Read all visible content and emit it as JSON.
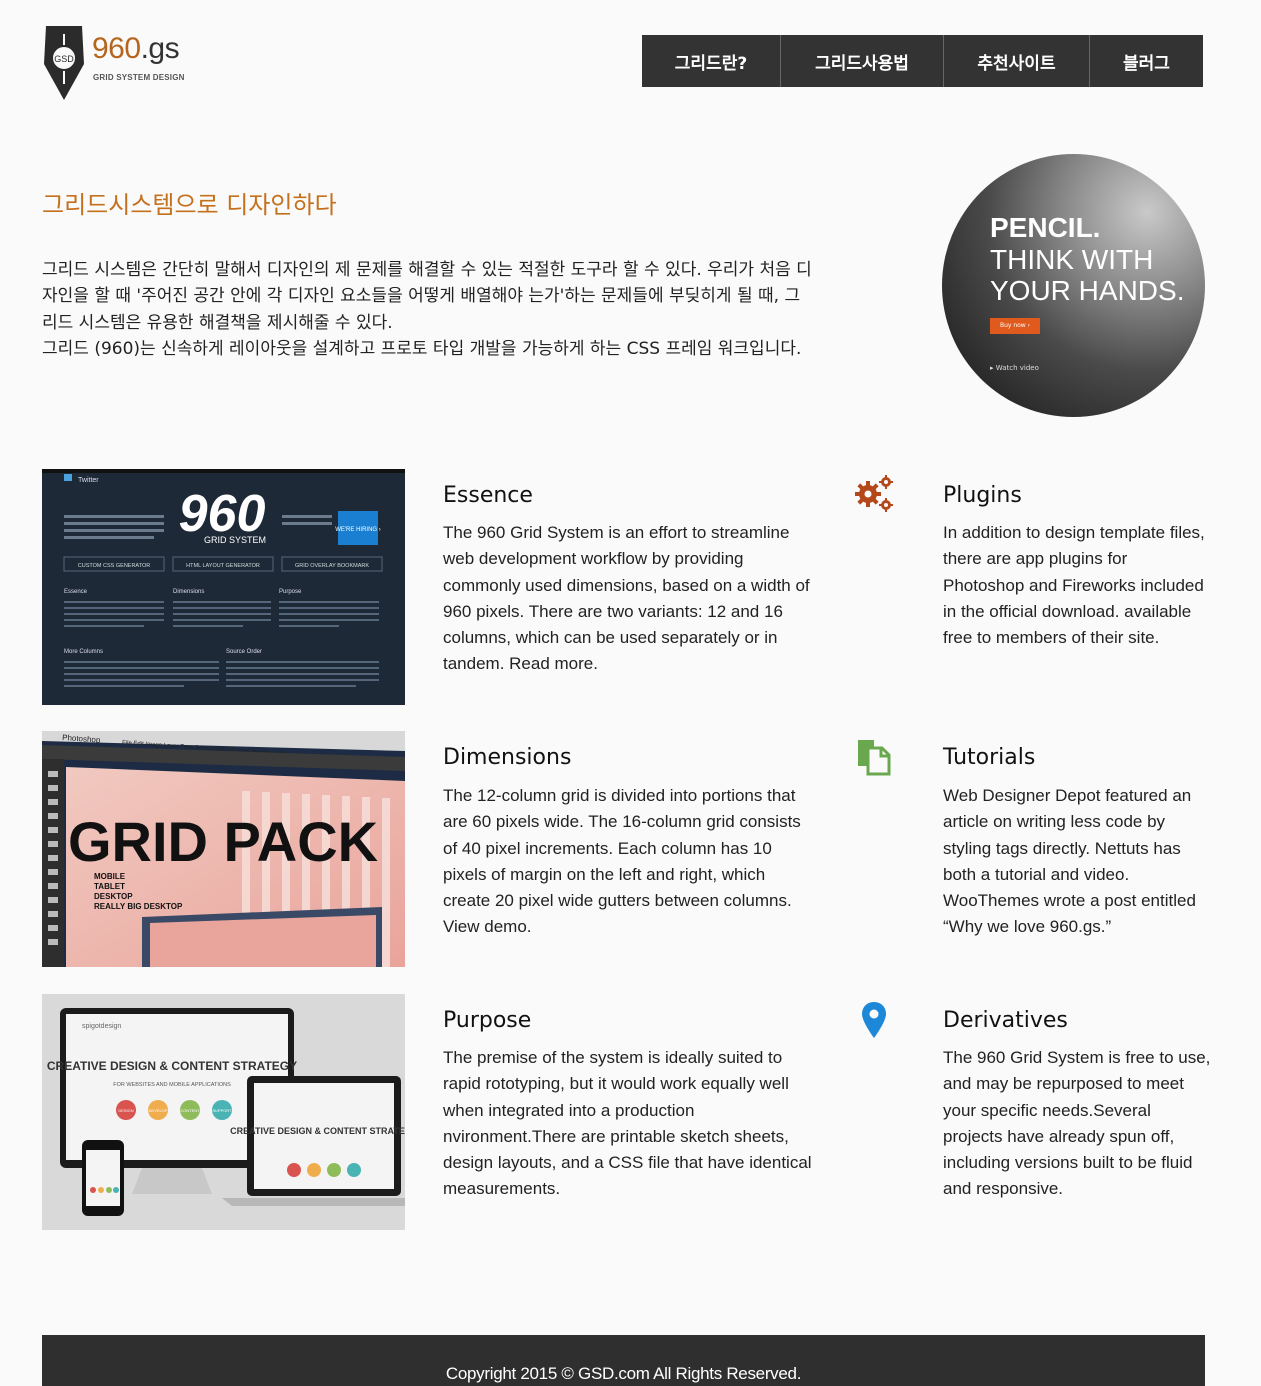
{
  "logo": {
    "badge_text": "GSD",
    "brand_prefix": "960",
    "brand_suffix": ".gs",
    "tagline": "GRID SYSTEM DESIGN"
  },
  "nav": {
    "items": [
      {
        "label": "그리드란?"
      },
      {
        "label": "그리드사용법"
      },
      {
        "label": "추천사이트"
      },
      {
        "label": "블러그"
      }
    ]
  },
  "intro": {
    "title": "그리드시스템으로 디자인하다",
    "paragraph1": "그리드 시스템은 간단히 말해서 디자인의 제 문제를 해결할 수 있는 적절한 도구라 할 수 있다. 우리가 처음 디자인을 할 때 '주어진 공간 안에 각 디자인 요소들을 어떻게 배열해야 는가'하는 문제들에 부딪히게 될 때, 그리드 시스템은 유용한 해결책을 제시해줄 수 있다.",
    "paragraph2": "그리드 (960)는 신속하게 레이아웃을 설계하고 프로토 타입 개발을 가능하게 하는 CSS 프레임 워크입니다."
  },
  "hero_image": {
    "line1": "PENCIL.",
    "line2": "THINK WITH",
    "line3": "YOUR HANDS.",
    "button": "Buy now ›",
    "watch": "▸ Watch video"
  },
  "thumbnails": {
    "essence": {
      "brand": "Twitter",
      "number": "960",
      "caption": "GRID SYSTEM",
      "hiring": "WE'RE HIRING ›",
      "tab1": "CUSTOM CSS GENERATOR",
      "tab2": "HTML LAYOUT GENERATOR",
      "tab3": "GRID OVERLAY BOOKMARK",
      "h1": "Essence",
      "h2": "Dimensions",
      "h3": "Purpose",
      "h4": "More Columns",
      "h5": "Source Order"
    },
    "dimensions": {
      "app": "Photoshop",
      "menu": "File  Edit  Image  Layer  Type  Select  Filter  3D  View  Window  Help",
      "headline": "GRID PACK",
      "l1": "MOBILE",
      "l2": "TABLET",
      "l3": "DESKTOP",
      "l4": "REALLY BIG DESKTOP"
    },
    "purpose": {
      "brand": "spigotdesign",
      "headline": "CREATIVE DESIGN & CONTENT STRATEGY",
      "sub": "FOR WEBSITES AND MOBILE APPLICATIONS",
      "b1": "DESIGN",
      "b2": "DEVELOP",
      "b3": "CONTENT",
      "b4": "SUPPORT"
    }
  },
  "features": {
    "essence": {
      "title": "Essence",
      "text": "The 960 Grid System is an effort to streamline web development workflow by providing commonly used dimensions, based on a width of 960 pixels. There are two variants: 12 and 16 columns, which can be used separately or in tandem. Read more."
    },
    "dimensions": {
      "title": "Dimensions",
      "text": "The 12-column grid is divided into portions that are 60 pixels wide. The 16-column grid consists of 40 pixel increments. Each column has 10 pixels of margin on the left and right, which create 20 pixel wide gutters between columns. View demo."
    },
    "purpose": {
      "title": "Purpose",
      "text": "The premise of the system is ideally suited to rapid rototyping, but it would work equally well when integrated into a production nvironment.There are printable sketch sheets, design layouts, and a CSS file that have identical measurements."
    },
    "plugins": {
      "title": "Plugins",
      "text": "In addition to design template files, there are app plugins for Photoshop and Fireworks included in the official download. available free to members of their site.",
      "icon": "gears-icon",
      "icon_color": "#b5481a"
    },
    "tutorials": {
      "title": "Tutorials",
      "text": "Web Designer Depot featured an article on writing less code by styling tags directly. Nettuts has both a tutorial and video. WooThemes wrote a post entitled “Why we love 960.gs.”",
      "icon": "documents-icon",
      "icon_color": "#6aa84f"
    },
    "derivatives": {
      "title": "Derivatives",
      "text": "The 960 Grid System is free to use, and may be repurposed to meet your specific needs.Several projects have already spun off, including versions built to be fluid and responsive.",
      "icon": "map-pin-icon",
      "icon_color": "#1e88d8"
    }
  },
  "footer": {
    "copyright": "Copyright 2015 © GSD.com All Rights Reserved."
  },
  "colors": {
    "accent": "#c5701c",
    "nav_bg": "#333333",
    "footer_bg": "#2f2f2f"
  }
}
